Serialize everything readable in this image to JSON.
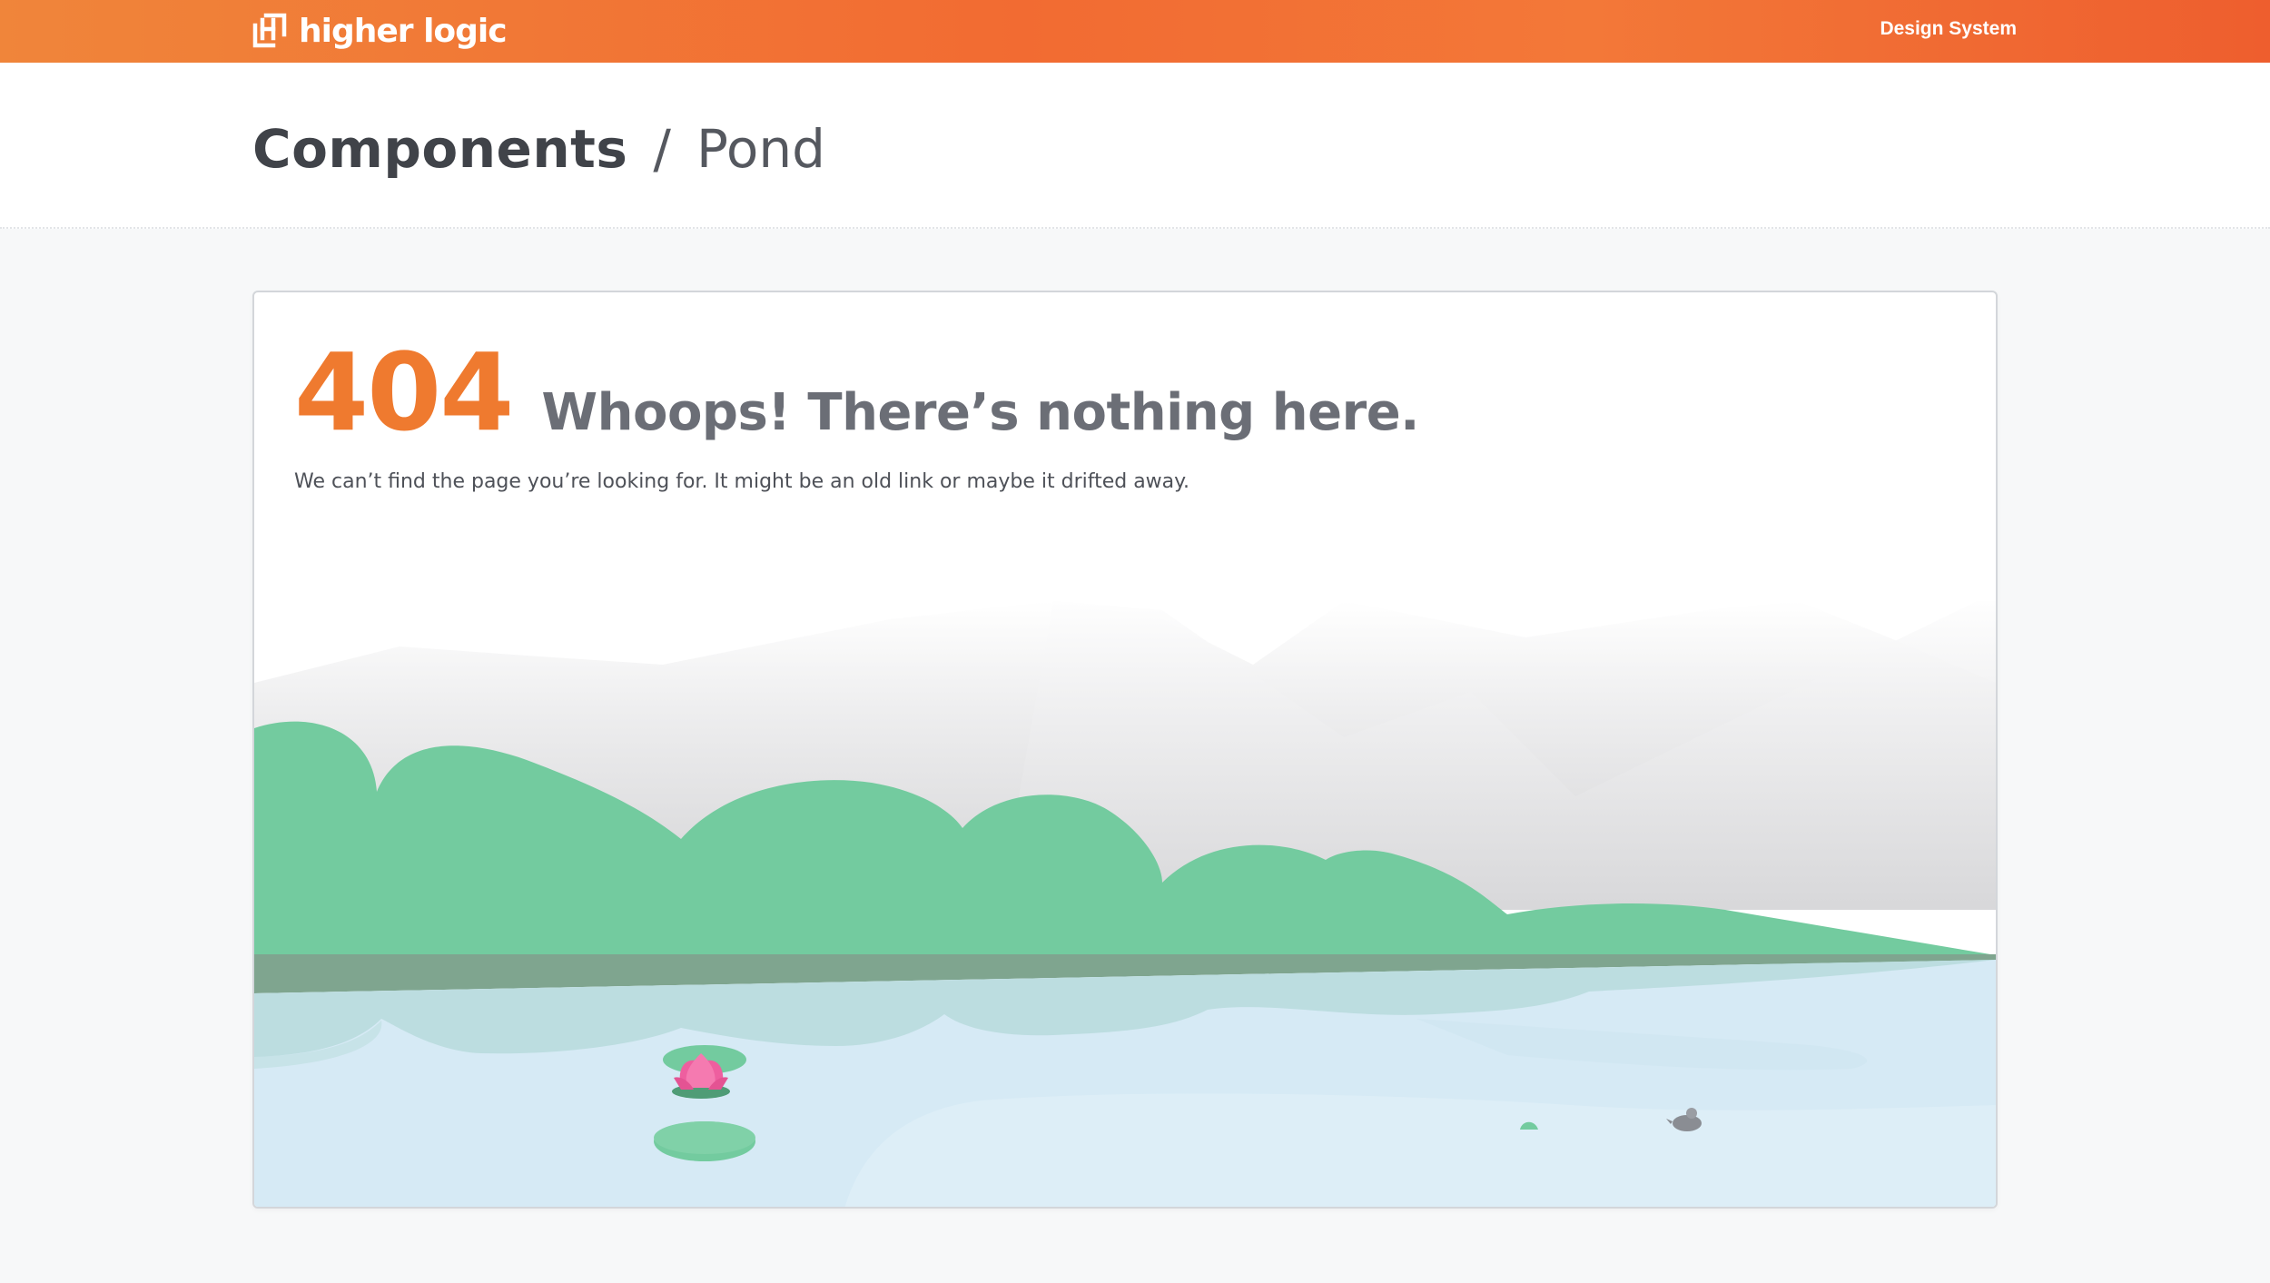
{
  "header": {
    "brand": "higher logic",
    "brand_icon": "higher-logic-logo-icon",
    "nav_link": "Design System"
  },
  "breadcrumb": {
    "parent": "Components",
    "separator": "/",
    "current": "Pond"
  },
  "error": {
    "code": "404",
    "title": "Whoops! There’s nothing here.",
    "message": "We can’t find the page you’re looking for. It might be an old link or maybe it drifted away."
  },
  "illustration": {
    "name": "pond-scene",
    "elements": [
      "mountains",
      "green-hills",
      "pond-water",
      "lily-pad-with-lotus",
      "duck"
    ]
  },
  "colors": {
    "brand_orange": "#ef7a2f",
    "header_gradient_start": "#f0853a",
    "header_gradient_end": "#ee5e2e",
    "hills": "#73cb9f",
    "water": "#d6eaf5",
    "lotus": "#ee5f9f"
  }
}
